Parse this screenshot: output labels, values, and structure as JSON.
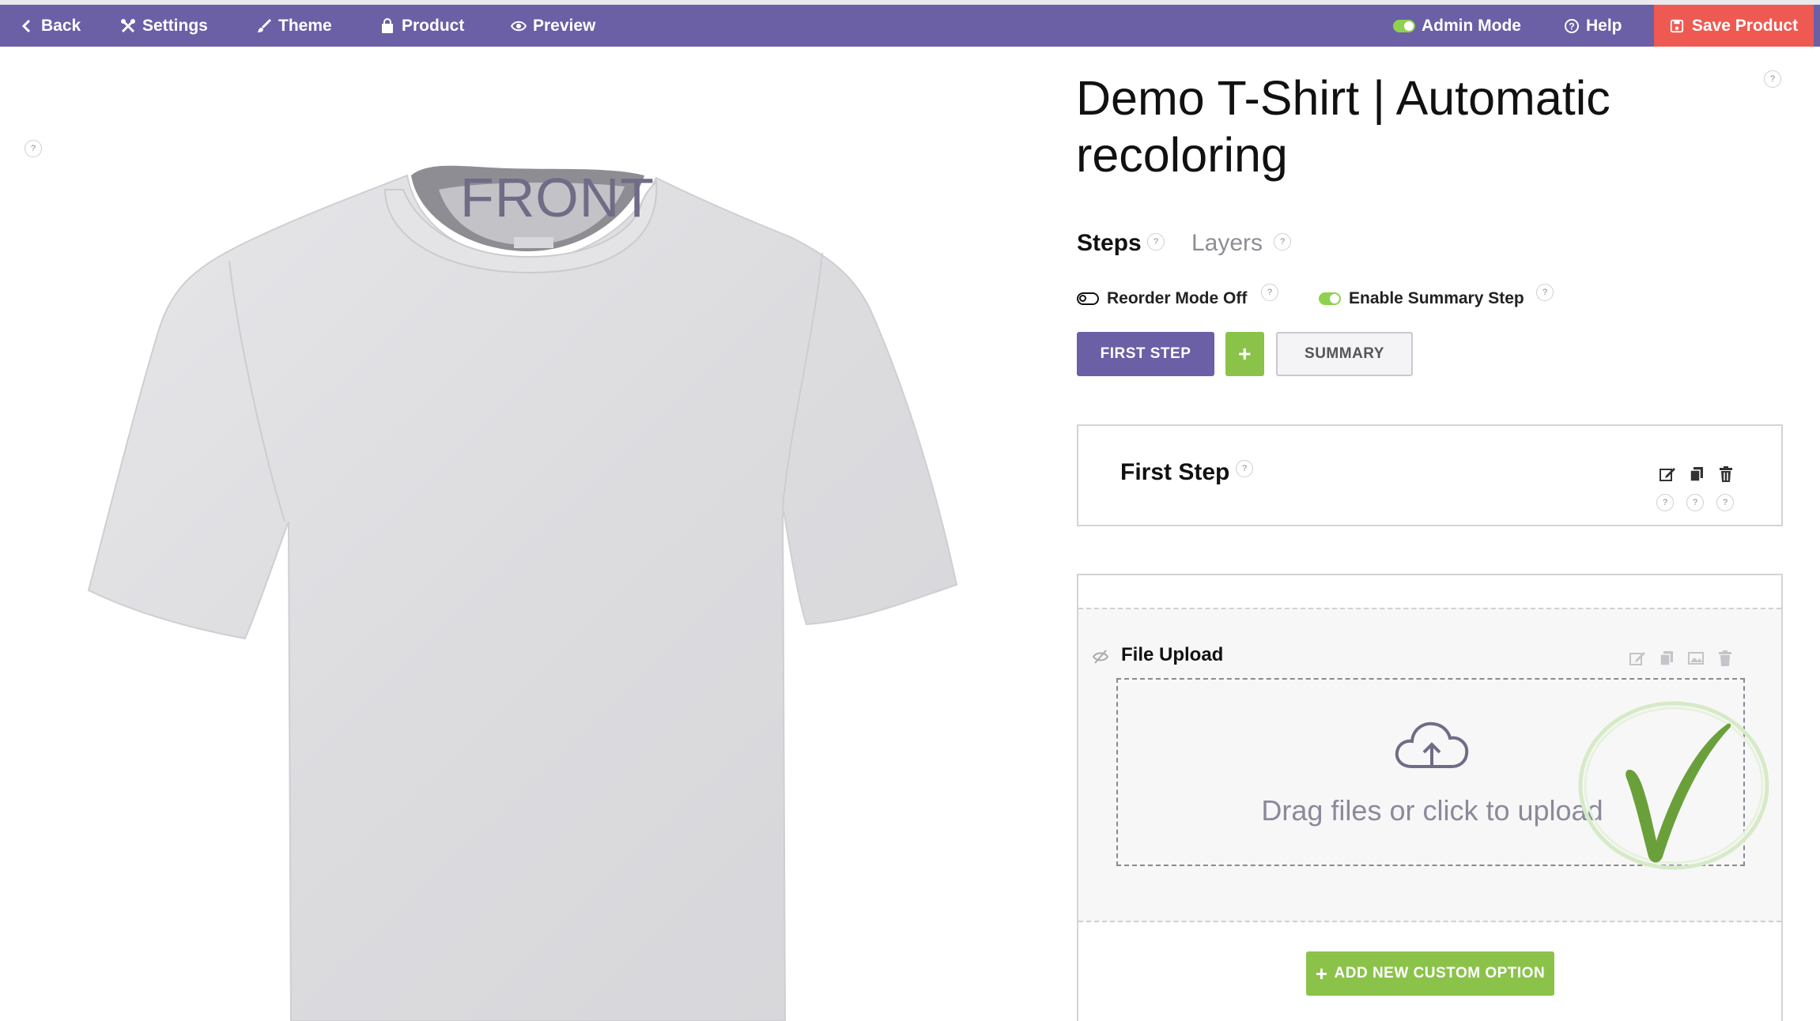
{
  "topbar": {
    "back": "Back",
    "settings": "Settings",
    "theme": "Theme",
    "product": "Product",
    "preview": "Preview",
    "admin_mode": "Admin Mode",
    "help": "Help",
    "save": "Save Product",
    "bg_color": "#6b5fa6",
    "save_color": "#ee5a52"
  },
  "preview": {
    "side_label": "FRONT",
    "help": "?"
  },
  "product": {
    "title": "Demo T-Shirt | Automatic recoloring",
    "help": "?"
  },
  "tabs": {
    "steps": "Steps",
    "layers": "Layers"
  },
  "options": {
    "reorder": "Reorder Mode Off",
    "summary_step": "Enable Summary Step"
  },
  "step_buttons": {
    "first": "FIRST STEP",
    "add": "+",
    "summary": "SUMMARY"
  },
  "step_card": {
    "title": "First Step"
  },
  "file_upload": {
    "title": "File Upload",
    "dropzone_text": "Drag files or click to upload"
  },
  "add_option": {
    "label": "ADD NEW CUSTOM OPTION",
    "color": "#8bc34a"
  },
  "help_glyph": "?"
}
